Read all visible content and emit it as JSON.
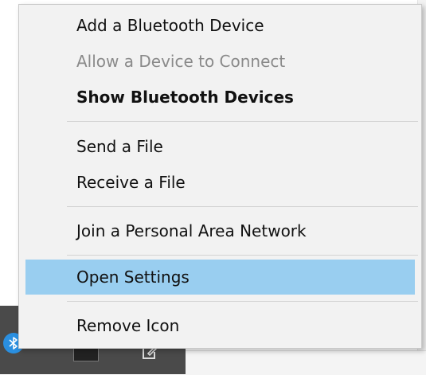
{
  "menu": {
    "items": [
      {
        "label": "Add a Bluetooth Device"
      },
      {
        "label": "Allow a Device to Connect",
        "disabled": true
      },
      {
        "label": "Show Bluetooth Devices",
        "bold": true
      },
      {
        "label": "Send a File"
      },
      {
        "label": "Receive a File"
      },
      {
        "label": "Join a Personal Area Network"
      },
      {
        "label": "Open Settings",
        "highlighted": true
      },
      {
        "label": "Remove Icon"
      }
    ]
  },
  "taskbar": {
    "icons": [
      "bluetooth-icon",
      "app-icon",
      "notes-icon"
    ]
  },
  "colors": {
    "menu_bg": "#f2f2f2",
    "highlight": "#99cef0",
    "disabled_text": "#8a8a8a",
    "taskbar": "#4a4a4a",
    "bluetooth_accent": "#2a8fe0"
  }
}
